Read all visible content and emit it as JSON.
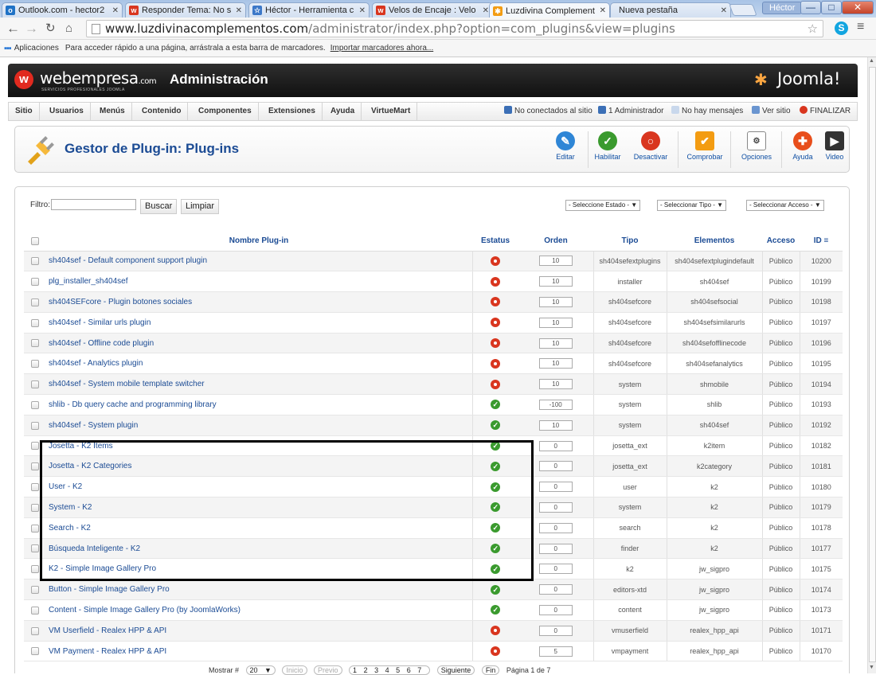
{
  "browser": {
    "tabs": [
      {
        "label": "Outlook.com - hector2",
        "icon_color": "#1f72c6",
        "icon_text": "o"
      },
      {
        "label": "Responder Tema: No s",
        "icon_color": "#d9361f",
        "icon_text": "w"
      },
      {
        "label": "Héctor - Herramienta c",
        "icon_color": "#3c78c8",
        "icon_text": "☆"
      },
      {
        "label": "Velos de Encaje : Velo",
        "icon_color": "#d9361f",
        "icon_text": "w"
      },
      {
        "label": "Luzdivina Complement",
        "icon_color": "#f39c12",
        "icon_text": "✱"
      },
      {
        "label": "Nueva pestaña",
        "icon_color": "",
        "icon_text": ""
      }
    ],
    "user_badge": "Héctor",
    "window_buttons": {
      "minimize": "—",
      "maximize": "□",
      "close": "✕"
    },
    "url_host": "www.luzdivinacomplementos.com",
    "url_path": "/administrator/index.php?option=com_plugins&view=plugins",
    "bookmarks": {
      "apps_label": "Aplicaciones",
      "hint": "Para acceder rápido a una página, arrástrala a esta barra de marcadores.",
      "import_link": "Importar marcadores ahora..."
    }
  },
  "header": {
    "logo_text": "webempresa",
    "logo_suffix": ".com",
    "tagline": "SERVICIOS PROFESIONALES JOOMLA",
    "admin_title": "Administración",
    "joomla_text": "Joomla!"
  },
  "menubar": {
    "items": [
      "Sitio",
      "Usuarios",
      "Menús",
      "Contenido",
      "Componentes",
      "Extensiones",
      "Ayuda",
      "VirtueMart"
    ],
    "status": {
      "not_connected": "No conectados al sitio",
      "admins": "1 Administrador",
      "messages": "No hay mensajes",
      "view_site": "Ver sitio",
      "logout": "FINALIZAR"
    }
  },
  "toolbar": {
    "title": "Gestor de Plug-in: Plug-ins",
    "buttons": {
      "edit": "Editar",
      "enable": "Habilitar",
      "disable": "Desactivar",
      "check": "Comprobar",
      "options": "Opciones",
      "help": "Ayuda",
      "video": "Video"
    }
  },
  "filters": {
    "label": "Filtro:",
    "search_value": "",
    "search_button": "Buscar",
    "clear_button": "Limpiar",
    "state_select": "- Seleccione Estado -",
    "type_select": "- Seleccionar Tipo -",
    "access_select": "- Seleccionar Acceso -"
  },
  "table": {
    "headers": {
      "name": "Nombre Plug-in",
      "status": "Estatus",
      "order": "Orden",
      "type": "Tipo",
      "element": "Elementos",
      "access": "Acceso",
      "id": "ID"
    },
    "rows": [
      {
        "name": "sh404sef - Default component support plugin",
        "enabled": false,
        "order": "10",
        "type": "sh404sefextplugins",
        "element": "sh404sefextplugindefault",
        "access": "Público",
        "id": "10200"
      },
      {
        "name": "plg_installer_sh404sef",
        "enabled": false,
        "order": "10",
        "type": "installer",
        "element": "sh404sef",
        "access": "Público",
        "id": "10199"
      },
      {
        "name": "sh404SEFcore - Plugin botones sociales",
        "enabled": false,
        "order": "10",
        "type": "sh404sefcore",
        "element": "sh404sefsocial",
        "access": "Público",
        "id": "10198"
      },
      {
        "name": "sh404sef - Similar urls plugin",
        "enabled": false,
        "order": "10",
        "type": "sh404sefcore",
        "element": "sh404sefsimilarurls",
        "access": "Público",
        "id": "10197"
      },
      {
        "name": "sh404sef - Offline code plugin",
        "enabled": false,
        "order": "10",
        "type": "sh404sefcore",
        "element": "sh404sefofflinecode",
        "access": "Público",
        "id": "10196"
      },
      {
        "name": "sh404sef - Analytics plugin",
        "enabled": false,
        "order": "10",
        "type": "sh404sefcore",
        "element": "sh404sefanalytics",
        "access": "Público",
        "id": "10195"
      },
      {
        "name": "sh404sef - System mobile template switcher",
        "enabled": false,
        "order": "10",
        "type": "system",
        "element": "shmobile",
        "access": "Público",
        "id": "10194"
      },
      {
        "name": "shlib - Db query cache and programming library",
        "enabled": true,
        "order": "-100",
        "type": "system",
        "element": "shlib",
        "access": "Público",
        "id": "10193"
      },
      {
        "name": "sh404sef - System plugin",
        "enabled": true,
        "order": "10",
        "type": "system",
        "element": "sh404sef",
        "access": "Público",
        "id": "10192"
      },
      {
        "name": "Josetta - K2 Items",
        "enabled": true,
        "order": "0",
        "type": "josetta_ext",
        "element": "k2item",
        "access": "Público",
        "id": "10182"
      },
      {
        "name": "Josetta - K2 Categories",
        "enabled": true,
        "order": "0",
        "type": "josetta_ext",
        "element": "k2category",
        "access": "Público",
        "id": "10181"
      },
      {
        "name": "User - K2",
        "enabled": true,
        "order": "0",
        "type": "user",
        "element": "k2",
        "access": "Público",
        "id": "10180"
      },
      {
        "name": "System - K2",
        "enabled": true,
        "order": "0",
        "type": "system",
        "element": "k2",
        "access": "Público",
        "id": "10179"
      },
      {
        "name": "Search - K2",
        "enabled": true,
        "order": "0",
        "type": "search",
        "element": "k2",
        "access": "Público",
        "id": "10178"
      },
      {
        "name": "Búsqueda Inteligente - K2",
        "enabled": true,
        "order": "0",
        "type": "finder",
        "element": "k2",
        "access": "Público",
        "id": "10177"
      },
      {
        "name": "K2 - Simple Image Gallery Pro",
        "enabled": true,
        "order": "0",
        "type": "k2",
        "element": "jw_sigpro",
        "access": "Público",
        "id": "10175"
      },
      {
        "name": "Button - Simple Image Gallery Pro",
        "enabled": true,
        "order": "0",
        "type": "editors-xtd",
        "element": "jw_sigpro",
        "access": "Público",
        "id": "10174"
      },
      {
        "name": "Content - Simple Image Gallery Pro (by JoomlaWorks)",
        "enabled": true,
        "order": "0",
        "type": "content",
        "element": "jw_sigpro",
        "access": "Público",
        "id": "10173"
      },
      {
        "name": "VM Userfield - Realex HPP & API",
        "enabled": false,
        "order": "0",
        "type": "vmuserfield",
        "element": "realex_hpp_api",
        "access": "Público",
        "id": "10171"
      },
      {
        "name": "VM Payment - Realex HPP & API",
        "enabled": false,
        "order": "5",
        "type": "vmpayment",
        "element": "realex_hpp_api",
        "access": "Público",
        "id": "10170"
      }
    ]
  },
  "pagination": {
    "show_label": "Mostrar #",
    "show_value": "20",
    "start": "Inicio",
    "prev": "Previo",
    "pages": [
      "1",
      "2",
      "3",
      "4",
      "5",
      "6",
      "7"
    ],
    "next": "Siguiente",
    "end": "Fin",
    "page_info": "Página 1 de 7"
  }
}
